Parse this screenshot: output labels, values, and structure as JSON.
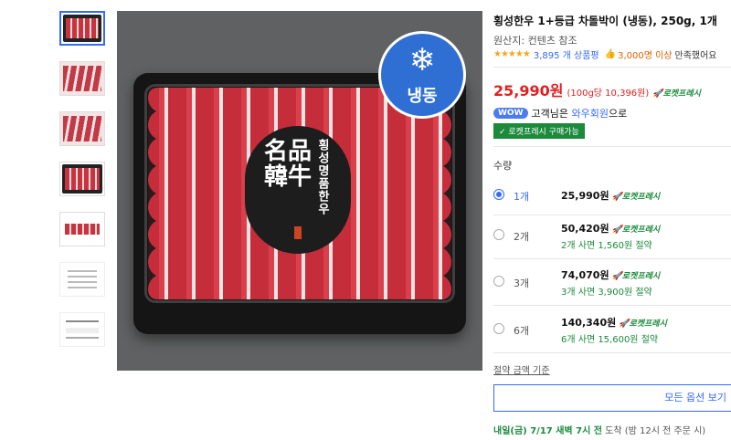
{
  "product": {
    "title": "횡성한우 1+등급 차돌박이 (냉동), 250g, 1개",
    "origin_label": "원산지:",
    "origin_value": "컨텐츠 참조",
    "stars": "★★★★★",
    "review_count": "3,895 개 상품평",
    "satisfaction_count": "3,000명 이상",
    "satisfaction_label": "만족했어요",
    "price": "25,990원",
    "unit_price": "(100g당 10,396원)",
    "rocket_label": "로켓프레시",
    "wow_badge": "WOW",
    "wow_text_before": "고객님은",
    "wow_link": "와우회원",
    "wow_text_after": "으로",
    "rocket_badge": "✓ 로켓프레시 구매가능"
  },
  "image": {
    "frozen_label": "냉동",
    "snow_glyph": "❄",
    "seal_vertical": "횡성명품한우",
    "seal_big": "名品韓牛"
  },
  "quantity": {
    "label": "수량",
    "options": [
      {
        "qty": "1개",
        "price": "25,990원",
        "rocket": "로켓프레시",
        "save": "",
        "selected": true
      },
      {
        "qty": "2개",
        "price": "50,420원",
        "rocket": "로켓프레시",
        "save": "2개 사면 1,560원 절약",
        "selected": false
      },
      {
        "qty": "3개",
        "price": "74,070원",
        "rocket": "로켓프레시",
        "save": "3개 사면 3,900원 절약",
        "selected": false
      },
      {
        "qty": "6개",
        "price": "140,340원",
        "rocket": "로켓프레시",
        "save": "6개 사면 15,600원 절약",
        "selected": false
      }
    ],
    "basis_link": "절약 금액 기준",
    "all_options_button": "모든 옵션 보기"
  },
  "delivery": {
    "date": "내일(금) 7/17 새벽 7시 전",
    "suffix": "도착",
    "note": "(밤 12시 전 주문 시)"
  },
  "colors": {
    "accent": "#346aff",
    "price_red": "#e02020",
    "rocket_green": "#1b8a3b"
  }
}
